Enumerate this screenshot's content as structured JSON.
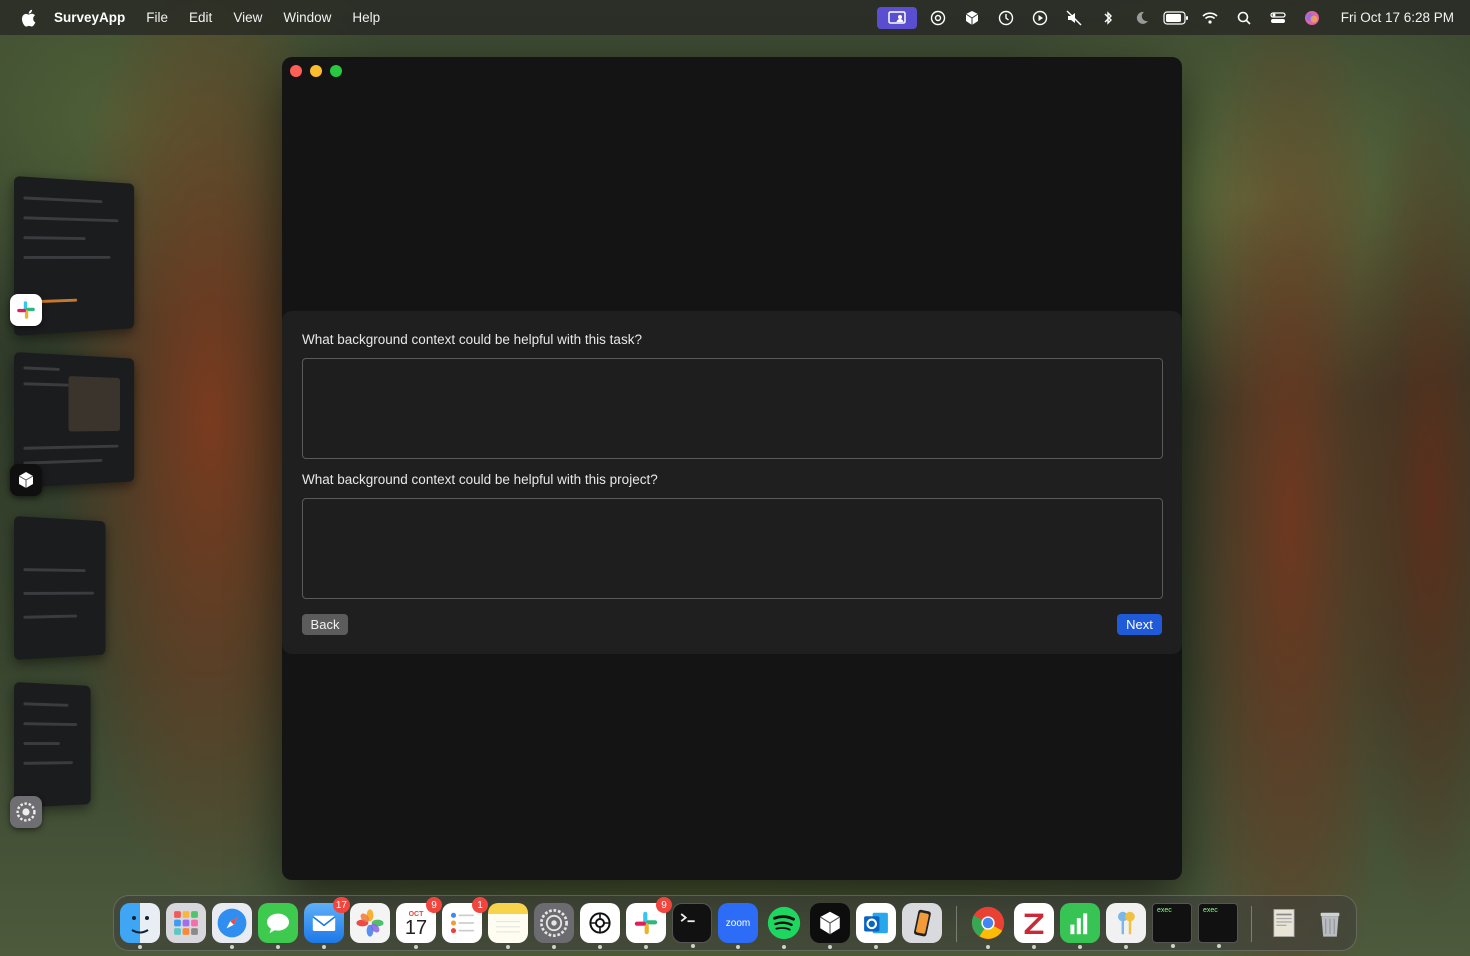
{
  "menubar": {
    "app_name": "SurveyApp",
    "menus": [
      "File",
      "Edit",
      "View",
      "Window",
      "Help"
    ],
    "clock": "Fri Oct 17  6:28 PM",
    "status_icons": [
      "screen-share-icon",
      "openai-icon",
      "cube-icon",
      "time-machine-icon",
      "play-circle-icon",
      "mute-icon",
      "bluetooth-icon",
      "moon-icon",
      "battery-icon",
      "wifi-icon",
      "search-icon",
      "control-center-icon",
      "siri-icon"
    ]
  },
  "survey": {
    "question_task": "What background context could be helpful with this task?",
    "answer_task": "",
    "question_project": "What background context could be helpful with this project?",
    "answer_project": "",
    "back_label": "Back",
    "next_label": "Next"
  },
  "dock": {
    "items": [
      {
        "name": "finder",
        "icon": "finder-icon",
        "running": true
      },
      {
        "name": "launchpad",
        "icon": "launchpad-icon",
        "running": false
      },
      {
        "name": "safari",
        "icon": "safari-icon",
        "running": true
      },
      {
        "name": "messages",
        "icon": "messages-icon",
        "running": true
      },
      {
        "name": "mail",
        "icon": "mail-icon",
        "running": true,
        "badge": "17"
      },
      {
        "name": "photos",
        "icon": "photos-icon",
        "running": false
      },
      {
        "name": "calendar",
        "icon": "calendar-icon",
        "running": true,
        "badge": "9",
        "month": "OCT",
        "day": "17"
      },
      {
        "name": "reminders",
        "icon": "reminders-icon",
        "running": false,
        "badge": "1"
      },
      {
        "name": "notes",
        "icon": "notes-icon",
        "running": true
      },
      {
        "name": "system-settings",
        "icon": "gear-icon",
        "running": true
      },
      {
        "name": "chatgpt",
        "icon": "openai-icon",
        "running": true
      },
      {
        "name": "slack",
        "icon": "slack-icon",
        "running": true,
        "badge": "9"
      },
      {
        "name": "terminal",
        "icon": "terminal-icon",
        "running": true
      },
      {
        "name": "zoom",
        "icon": "zoom-icon",
        "running": true,
        "label": "zoom"
      },
      {
        "name": "spotify",
        "icon": "spotify-icon",
        "running": true
      },
      {
        "name": "cube-app",
        "icon": "cube-icon",
        "running": true
      },
      {
        "name": "outlook",
        "icon": "outlook-icon",
        "running": true
      },
      {
        "name": "iphone-mirroring",
        "icon": "phone-icon",
        "running": false
      },
      {
        "name": "chrome",
        "icon": "chrome-icon",
        "running": true
      },
      {
        "name": "zotero",
        "icon": "zotero-icon",
        "running": true
      },
      {
        "name": "numbers",
        "icon": "chart-icon",
        "running": true
      },
      {
        "name": "keychain",
        "icon": "keys-icon",
        "running": true
      },
      {
        "name": "exec-1",
        "icon": "exec-icon",
        "running": true,
        "label": "exec"
      },
      {
        "name": "exec-2",
        "icon": "exec-icon",
        "running": true,
        "label": "exec"
      },
      {
        "name": "documents",
        "icon": "document-stack-icon",
        "running": false
      },
      {
        "name": "trash",
        "icon": "trash-icon",
        "running": false
      }
    ]
  },
  "colors": {
    "window_bg": "#141414",
    "panel_bg": "#1f1f1f",
    "next_button": "#1f5bd8",
    "back_button": "#5c5c5c",
    "accent_status": "#5b4fd1"
  }
}
